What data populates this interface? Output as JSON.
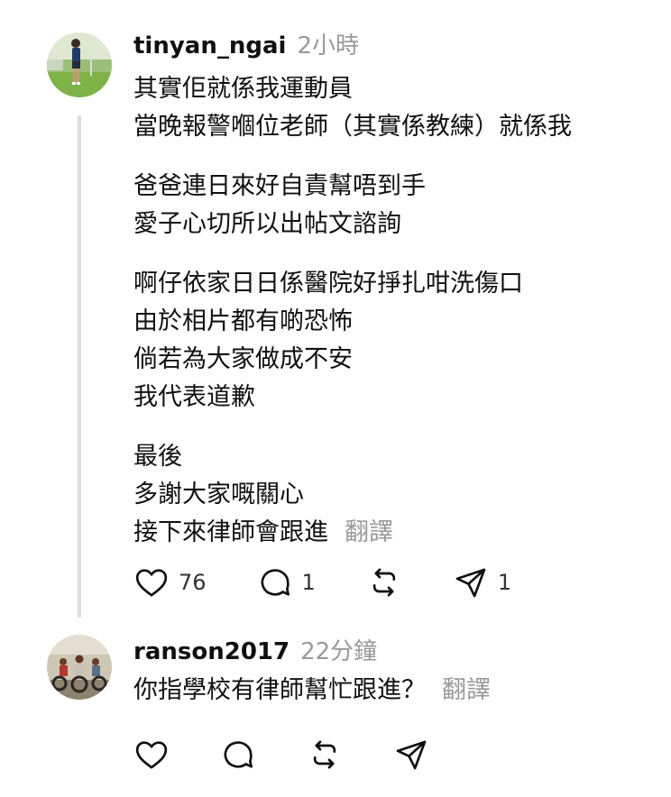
{
  "post1": {
    "username": "tinyan_ngai",
    "time": "2小時",
    "paragraphs": [
      [
        "其實佢就係我運動員",
        "當晚報警嗰位老師（其實係教練）就係我"
      ],
      [
        "爸爸連日來好自責幫唔到手",
        "愛子心切所以出帖文諮詢"
      ],
      [
        "啊仔依家日日係醫院好掙扎咁洗傷口",
        "由於相片都有啲恐怖",
        "倘若為大家做成不安",
        "我代表道歉"
      ],
      [
        "最後",
        "多謝大家嘅關心",
        "接下來律師會跟進"
      ]
    ],
    "translate_label": "翻譯",
    "actions": {
      "like_count": "76",
      "comment_count": "1",
      "share_count": "1",
      "icons": [
        "heart-icon",
        "comment-icon",
        "repost-icon",
        "send-icon"
      ]
    }
  },
  "post2": {
    "username": "ranson2017",
    "time": "22分鐘",
    "text": "你指學校有律師幫忙跟進？",
    "translate_label": "翻譯",
    "actions": {
      "icons": [
        "heart-icon",
        "comment-icon",
        "repost-icon",
        "send-icon"
      ]
    }
  }
}
